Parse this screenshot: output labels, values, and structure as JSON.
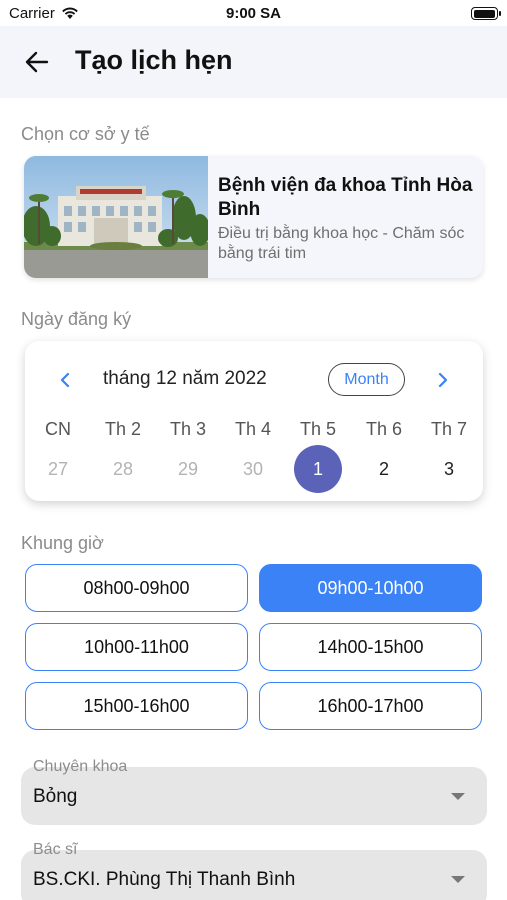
{
  "status_bar": {
    "carrier": "Carrier",
    "time": "9:00 SA",
    "battery_level": 1.0
  },
  "header": {
    "title": "Tạo lịch hẹn",
    "back_icon": "arrow-left-icon"
  },
  "facility": {
    "label": "Chọn cơ sở y tế",
    "name": "Bệnh viện đa khoa Tỉnh Hòa Bình",
    "slogan": "Điều trị bằng khoa học - Chăm sóc bằng trái tim"
  },
  "registration_date": {
    "label": "Ngày đăng ký",
    "calendar": {
      "month_title": "tháng 12 năm 2022",
      "mode_button": "Month",
      "weekdays": [
        "CN",
        "Th 2",
        "Th 3",
        "Th 4",
        "Th 5",
        "Th 6",
        "Th 7"
      ],
      "days": [
        {
          "label": "27",
          "state": "muted"
        },
        {
          "label": "28",
          "state": "muted"
        },
        {
          "label": "29",
          "state": "muted"
        },
        {
          "label": "30",
          "state": "muted"
        },
        {
          "label": "1",
          "state": "selected"
        },
        {
          "label": "2",
          "state": "normal"
        },
        {
          "label": "3",
          "state": "normal"
        }
      ],
      "accent_color": "#3b82f6",
      "selected_color": "#5a63b8"
    }
  },
  "time_slots": {
    "label": "Khung giờ",
    "slots": [
      {
        "label": "08h00-09h00",
        "active": false
      },
      {
        "label": "09h00-10h00",
        "active": true
      },
      {
        "label": "10h00-11h00",
        "active": false
      },
      {
        "label": "14h00-15h00",
        "active": false
      },
      {
        "label": "15h00-16h00",
        "active": false
      },
      {
        "label": "16h00-17h00",
        "active": false
      }
    ],
    "active_color": "#3b82f6"
  },
  "specialty": {
    "label": "Chuyên khoa",
    "value": "Bỏng"
  },
  "doctor": {
    "label": "Bác sĩ",
    "value": "BS.CKI. Phùng Thị Thanh Bình"
  }
}
